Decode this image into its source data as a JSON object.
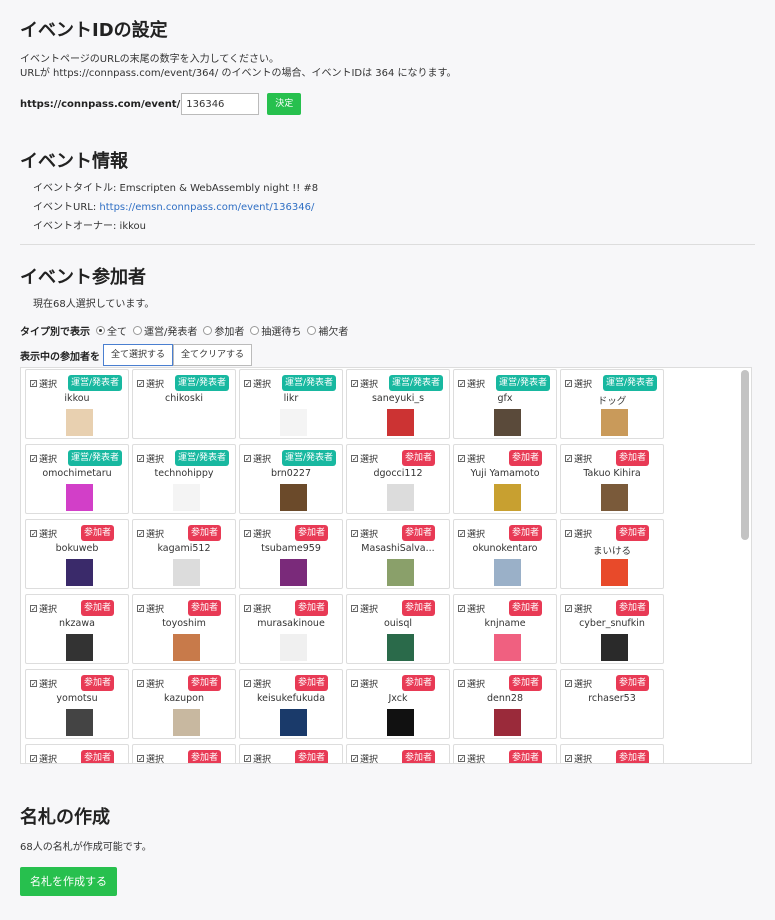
{
  "event_id": {
    "title": "イベントIDの設定",
    "desc1": "イベントページのURLの末尾の数字を入力してください。",
    "desc2": "URLが https://connpass.com/event/364/ のイベントの場合、イベントIDは 364 になります。",
    "prefix": "https://connpass.com/event/",
    "value": "136346",
    "submit": "決定"
  },
  "event_info": {
    "title": "イベント情報",
    "event_title": "イベントタイトル: Emscripten & WebAssembly night !! #8",
    "url_label": "イベントURL: ",
    "url": "https://emsn.connpass.com/event/136346/",
    "owner": "イベントオーナー: ikkou"
  },
  "participants": {
    "title": "イベント参加者",
    "status": "現在68人選択しています。",
    "filter_label": "タイプ別で表示",
    "filters": [
      "全て",
      "運営/発表者",
      "参加者",
      "抽選待ち",
      "補欠者"
    ],
    "filter_selected": "全て",
    "select_label": "表示中の参加者を",
    "select_all": "全て選択する",
    "clear_all": "全てクリアする",
    "select_text": "選択",
    "cards": [
      {
        "name": "ikkou",
        "badge": "運営/発表者",
        "type": "staff",
        "avatar": "#e8d0b0"
      },
      {
        "name": "chikoski",
        "badge": "運営/発表者",
        "type": "staff",
        "avatar": "#ffffff"
      },
      {
        "name": "likr",
        "badge": "運営/発表者",
        "type": "staff",
        "avatar": "#f4f4f4"
      },
      {
        "name": "saneyuki_s",
        "badge": "運営/発表者",
        "type": "staff",
        "avatar": "#c33"
      },
      {
        "name": "gfx",
        "badge": "運営/発表者",
        "type": "staff",
        "avatar": "#5a4a3a"
      },
      {
        "name": "ドッグ",
        "badge": "運営/発表者",
        "type": "staff",
        "avatar": "#c99a5a"
      },
      {
        "name": "omochimetaru",
        "badge": "運営/発表者",
        "type": "staff",
        "avatar": "#d23fc8"
      },
      {
        "name": "technohippy",
        "badge": "運営/発表者",
        "type": "staff",
        "avatar": "#f4f4f4"
      },
      {
        "name": "brn0227",
        "badge": "運営/発表者",
        "type": "staff",
        "avatar": "#6b4a2a"
      },
      {
        "name": "dgocci112",
        "badge": "参加者",
        "type": "part",
        "avatar": "#dcdcdc"
      },
      {
        "name": "Yuji Yamamoto",
        "badge": "参加者",
        "type": "part",
        "avatar": "#c8a030"
      },
      {
        "name": "Takuo Kihira",
        "badge": "参加者",
        "type": "part",
        "avatar": "#7a5a3a"
      },
      {
        "name": "bokuweb",
        "badge": "参加者",
        "type": "part",
        "avatar": "#3a2a6a"
      },
      {
        "name": "kagami512",
        "badge": "参加者",
        "type": "part",
        "avatar": "#dcdcdc"
      },
      {
        "name": "tsubame959",
        "badge": "参加者",
        "type": "part",
        "avatar": "#7a2a7a"
      },
      {
        "name": "MasashiSalva...",
        "badge": "参加者",
        "type": "part",
        "avatar": "#8aa06a"
      },
      {
        "name": "okunokentaro",
        "badge": "参加者",
        "type": "part",
        "avatar": "#9ab0c8"
      },
      {
        "name": "まいける",
        "badge": "参加者",
        "type": "part",
        "avatar": "#e84a2a"
      },
      {
        "name": "nkzawa",
        "badge": "参加者",
        "type": "part",
        "avatar": "#333333"
      },
      {
        "name": "toyoshim",
        "badge": "参加者",
        "type": "part",
        "avatar": "#c87a4a"
      },
      {
        "name": "murasakinoue",
        "badge": "参加者",
        "type": "part",
        "avatar": "#f0f0f0"
      },
      {
        "name": "ouisql",
        "badge": "参加者",
        "type": "part",
        "avatar": "#2a6a4a"
      },
      {
        "name": "knjname",
        "badge": "参加者",
        "type": "part",
        "avatar": "#f06080"
      },
      {
        "name": "cyber_snufkin",
        "badge": "参加者",
        "type": "part",
        "avatar": "#2a2a2a"
      },
      {
        "name": "yomotsu",
        "badge": "参加者",
        "type": "part",
        "avatar": "#444444"
      },
      {
        "name": "kazupon",
        "badge": "参加者",
        "type": "part",
        "avatar": "#c8b8a0"
      },
      {
        "name": "keisukefukuda",
        "badge": "参加者",
        "type": "part",
        "avatar": "#1a3a6a"
      },
      {
        "name": "Jxck",
        "badge": "参加者",
        "type": "part",
        "avatar": "#111111"
      },
      {
        "name": "denn28",
        "badge": "参加者",
        "type": "part",
        "avatar": "#9a2a3a"
      },
      {
        "name": "rchaser53",
        "badge": "参加者",
        "type": "part",
        "avatar": "#ffffff"
      },
      {
        "name": "",
        "badge": "参加者",
        "type": "part",
        "avatar": ""
      },
      {
        "name": "",
        "badge": "参加者",
        "type": "part",
        "avatar": ""
      },
      {
        "name": "",
        "badge": "参加者",
        "type": "part",
        "avatar": ""
      },
      {
        "name": "",
        "badge": "参加者",
        "type": "part",
        "avatar": ""
      },
      {
        "name": "",
        "badge": "参加者",
        "type": "part",
        "avatar": ""
      },
      {
        "name": "",
        "badge": "参加者",
        "type": "part",
        "avatar": ""
      }
    ]
  },
  "badges": {
    "title": "名札の作成",
    "desc": "68人の名札が作成可能です。",
    "create": "名札を作成する"
  },
  "colors": {
    "green": "#27c04e",
    "staff_badge": "#18b8a0",
    "participant_badge": "#e83a55",
    "link": "#2f6fc4"
  }
}
